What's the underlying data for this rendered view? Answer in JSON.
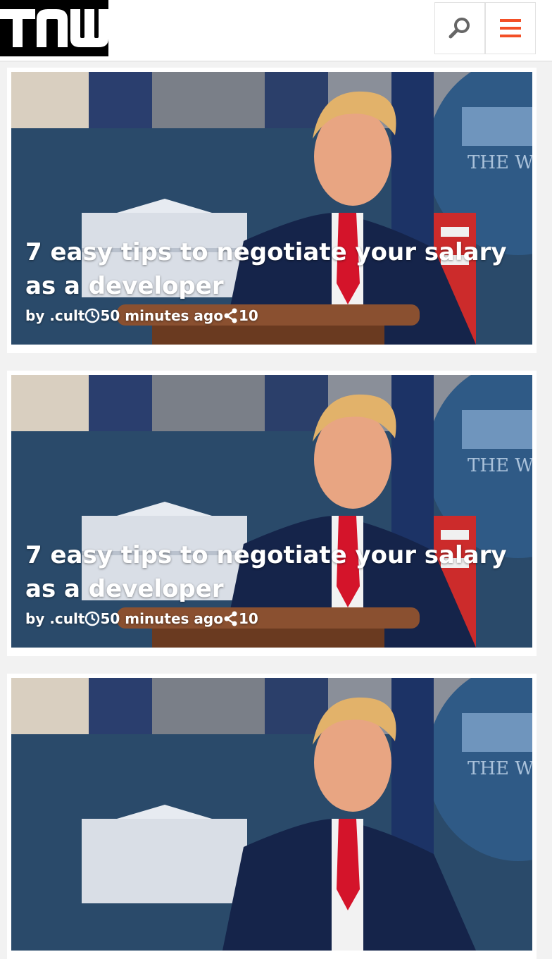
{
  "header": {
    "logo_icon": "tnw-logo",
    "search_icon": "search-icon",
    "menu_icon": "hamburger-menu-icon",
    "accent": "#f34f26"
  },
  "articles": [
    {
      "title": "7 easy tips to negotiate your salary as a developer",
      "author": "by .cult",
      "time": "50 minutes ago",
      "shares": "10",
      "image": "press-conference-photo"
    },
    {
      "title": "7 easy tips to negotiate your salary as a developer",
      "author": "by .cult",
      "time": "50 minutes ago",
      "shares": "10",
      "image": "press-conference-photo"
    },
    {
      "title": "",
      "author": "",
      "time": "",
      "shares": "",
      "image": "press-conference-photo"
    }
  ]
}
